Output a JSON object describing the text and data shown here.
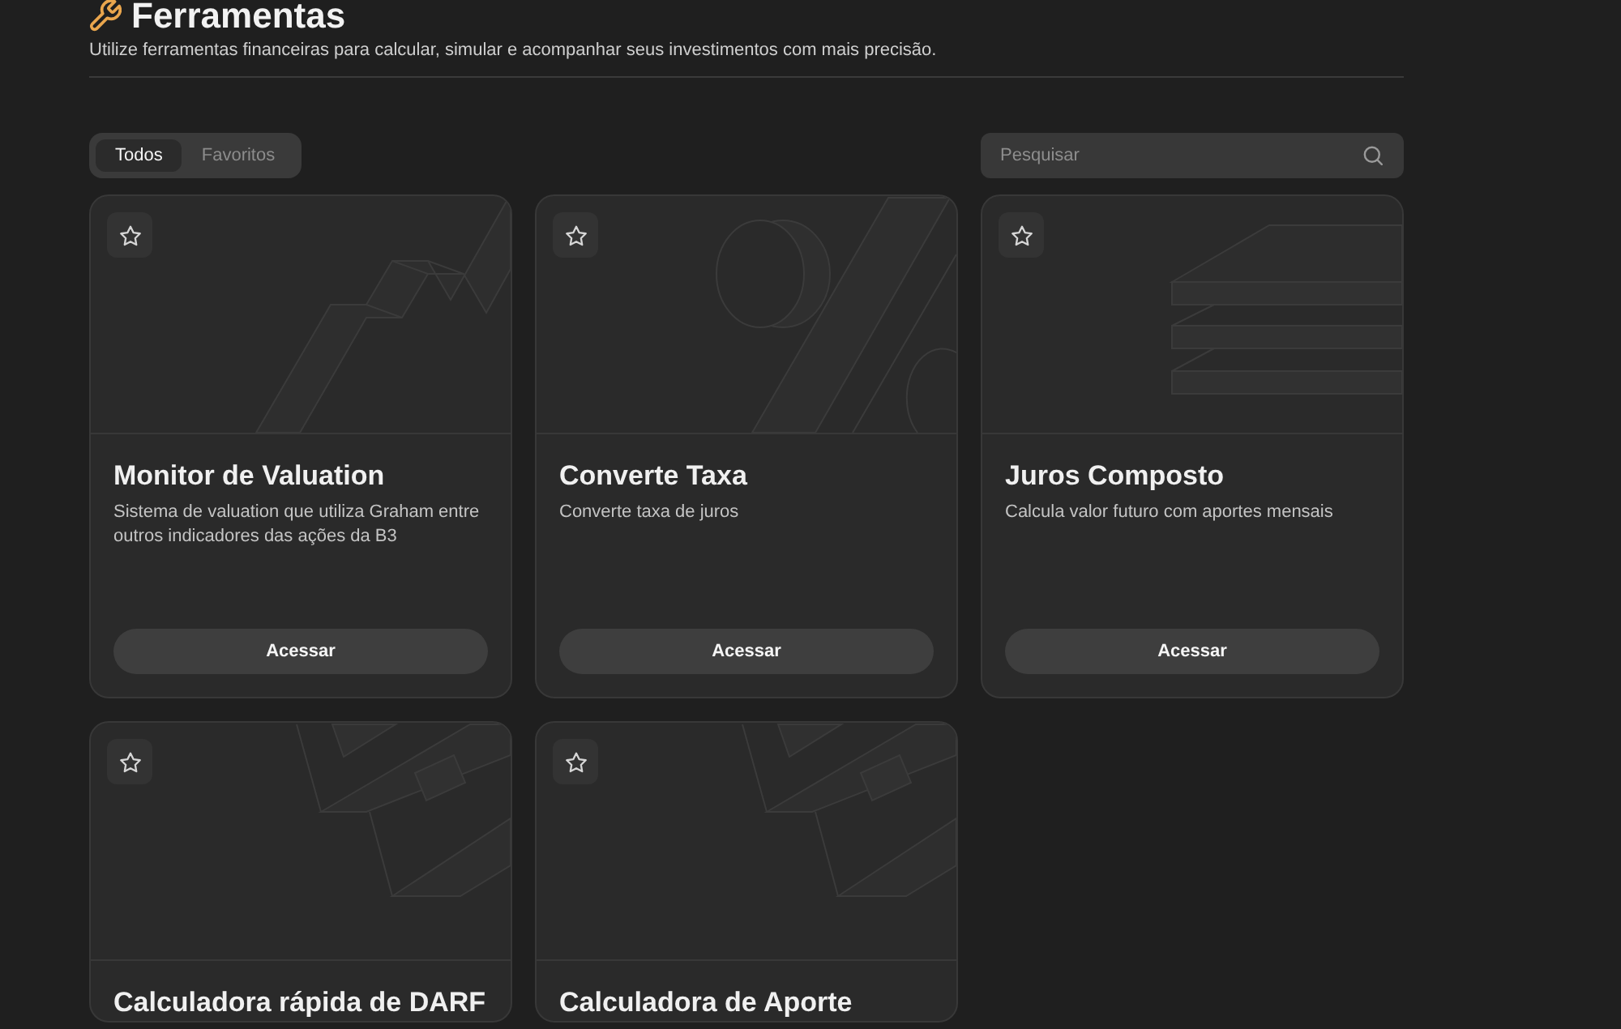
{
  "header": {
    "title": "Ferramentas",
    "subtitle": "Utilize ferramentas financeiras para calcular, simular e acompanhar seus investimentos com mais precisão."
  },
  "filter_tabs": [
    {
      "label": "Todos",
      "selected": true
    },
    {
      "label": "Favoritos",
      "selected": false
    }
  ],
  "search": {
    "placeholder": "Pesquisar"
  },
  "tools": [
    {
      "kind": "chart",
      "favorite": false,
      "title": "Monitor de Valuation",
      "description": "Sistema de valuation que utiliza Graham entre outros indicadores das ações da B3",
      "button": "Acessar"
    },
    {
      "kind": "percent",
      "favorite": false,
      "title": "Converte Taxa",
      "description": "Converte taxa de juros",
      "button": "Acessar"
    },
    {
      "kind": "layers",
      "favorite": false,
      "title": "Juros Composto",
      "description": "Calcula valor futuro com aportes mensais",
      "button": "Acessar"
    },
    {
      "kind": "blocks",
      "favorite": false,
      "title": "Calculadora rápida de DARF"
    },
    {
      "kind": "blocks",
      "favorite": false,
      "title": "Calculadora de Aporte"
    }
  ]
}
